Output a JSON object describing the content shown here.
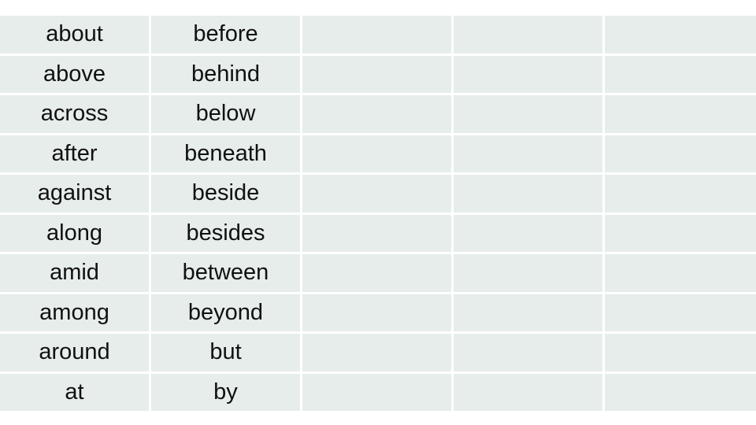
{
  "table": {
    "columns": 5,
    "colors": {
      "cell_background": "#e6edeb",
      "border": "#ffffff",
      "text": "#111111"
    },
    "rows": [
      [
        "about",
        "before",
        "",
        "",
        ""
      ],
      [
        "above",
        "behind",
        "",
        "",
        ""
      ],
      [
        "across",
        "below",
        "",
        "",
        ""
      ],
      [
        "after",
        "beneath",
        "",
        "",
        ""
      ],
      [
        "against",
        "beside",
        "",
        "",
        ""
      ],
      [
        "along",
        "besides",
        "",
        "",
        ""
      ],
      [
        "amid",
        "between",
        "",
        "",
        ""
      ],
      [
        "among",
        "beyond",
        "",
        "",
        ""
      ],
      [
        "around",
        "but",
        "",
        "",
        ""
      ],
      [
        "at",
        "by",
        "",
        "",
        ""
      ]
    ]
  }
}
